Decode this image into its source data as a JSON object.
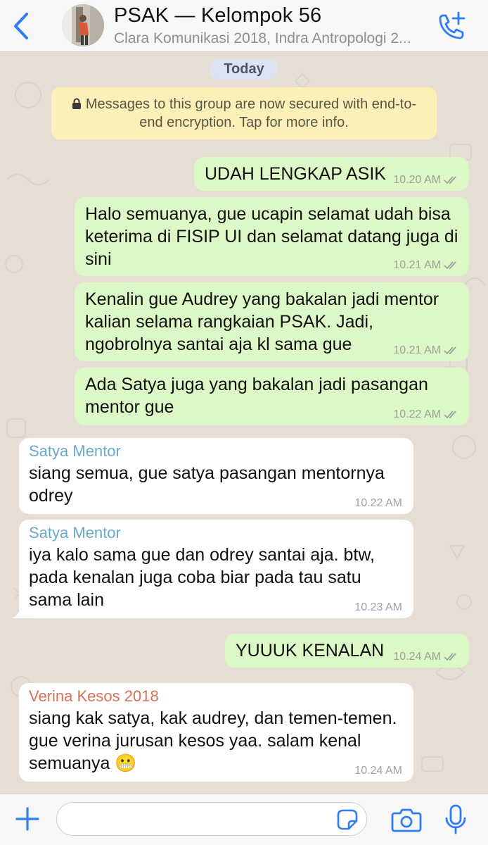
{
  "header": {
    "title": "PSAK — Kelompok 56",
    "subtitle": "Clara Komunikasi 2018, Indra Antropologi 2..."
  },
  "chat": {
    "day_label": "Today",
    "system_message": "Messages to this group are now secured with end-to-end encryption. Tap for more info.",
    "messages": [
      {
        "direction": "outgoing",
        "text": "UDAH LENGKAP ASIK",
        "time": "10.20 AM"
      },
      {
        "direction": "outgoing",
        "text": "Halo semuanya, gue ucapin selamat udah bisa keterima di FISIP UI dan selamat datang juga di sini",
        "time": "10.21 AM"
      },
      {
        "direction": "outgoing",
        "text": "Kenalin gue Audrey yang bakalan jadi mentor kalian selama rangkaian PSAK. Jadi, ngobrolnya santai aja kl sama gue",
        "time": "10.21 AM"
      },
      {
        "direction": "outgoing",
        "text": "Ada Satya juga yang bakalan jadi pasangan mentor gue",
        "time": "10.22 AM"
      },
      {
        "direction": "incoming",
        "sender": "Satya Mentor",
        "text": "siang semua, gue satya pasangan mentornya odrey",
        "time": "10.22 AM"
      },
      {
        "direction": "incoming",
        "sender": "Satya Mentor",
        "text": "iya kalo sama gue dan odrey santai aja. btw, pada kenalan juga coba biar pada tau satu sama lain",
        "time": "10.23 AM"
      },
      {
        "direction": "outgoing",
        "text": "YUUUK KENALAN",
        "time": "10.24 AM"
      },
      {
        "direction": "incoming",
        "sender": "Verina Kesos 2018",
        "text": "siang kak satya, kak audrey, dan temen-temen. gue verina jurusan kesos yaa. salam kenal semuanya 😬",
        "time": "10.24 AM"
      }
    ]
  },
  "input": {
    "value": "",
    "placeholder": ""
  },
  "colors": {
    "accent": "#2f7cf6",
    "outgoing_bubble": "#dcf8c6",
    "incoming_bubble": "#ffffff",
    "sender_satya": "#6aaac9",
    "sender_verina": "#d8715a",
    "wallpaper": "#e6ddd4",
    "system_banner": "#faf0b8"
  },
  "icons": {
    "back": "chevron-left-icon",
    "call": "add-call-icon",
    "lock": "lock-icon",
    "ticks": "double-check-icon",
    "plus": "plus-icon",
    "sticker": "sticker-icon",
    "camera": "camera-icon",
    "mic": "microphone-icon"
  }
}
